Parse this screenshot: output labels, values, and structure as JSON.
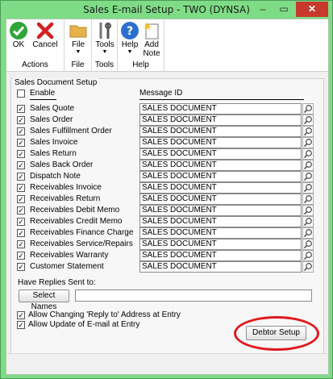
{
  "window": {
    "title": "Sales E-mail Setup  -  TWO (DYNSA)",
    "close_glyph": "✕",
    "min_glyph": "–",
    "max_glyph": "▭"
  },
  "ribbon": {
    "ok": "OK",
    "cancel": "Cancel",
    "actions_group": "Actions",
    "file": "File",
    "file_group": "File",
    "tools": "Tools",
    "tools_group": "Tools",
    "help": "Help",
    "add_note_1": "Add",
    "add_note_2": "Note",
    "help_group": "Help",
    "dropdown_glyph": "▼"
  },
  "setup": {
    "group_title": "Sales Document Setup",
    "enable_header": "Enable",
    "message_id_header": "Message ID",
    "rows": [
      {
        "label": "Sales Quote",
        "checked": true,
        "value": "SALES DOCUMENT"
      },
      {
        "label": "Sales Order",
        "checked": true,
        "value": "SALES DOCUMENT"
      },
      {
        "label": "Sales Fulfillment Order",
        "checked": true,
        "value": "SALES DOCUMENT"
      },
      {
        "label": "Sales Invoice",
        "checked": true,
        "value": "SALES DOCUMENT"
      },
      {
        "label": "Sales Return",
        "checked": true,
        "value": "SALES DOCUMENT"
      },
      {
        "label": "Sales Back Order",
        "checked": true,
        "value": "SALES DOCUMENT"
      },
      {
        "label": "Dispatch Note",
        "checked": true,
        "value": "SALES DOCUMENT"
      },
      {
        "label": "Receivables Invoice",
        "checked": true,
        "value": "SALES DOCUMENT"
      },
      {
        "label": "Receivables Return",
        "checked": true,
        "value": "SALES DOCUMENT"
      },
      {
        "label": "Receivables Debit Memo",
        "checked": true,
        "value": "SALES DOCUMENT"
      },
      {
        "label": "Receivables Credit Memo",
        "checked": true,
        "value": "SALES DOCUMENT"
      },
      {
        "label": "Receivables Finance Charge",
        "checked": true,
        "value": "SALES DOCUMENT"
      },
      {
        "label": "Receivables Service/Repairs",
        "checked": true,
        "value": "SALES DOCUMENT"
      },
      {
        "label": "Receivables Warranty",
        "checked": true,
        "value": "SALES DOCUMENT"
      },
      {
        "label": "Customer Statement",
        "checked": true,
        "value": "SALES DOCUMENT"
      }
    ],
    "replies_label": "Have Replies Sent to:",
    "select_names": "Select Names",
    "replies_value": "",
    "allow_reply": "Allow Changing 'Reply to' Address at Entry",
    "allow_reply_checked": true,
    "allow_update": "Allow Update of E-mail at Entry",
    "allow_update_checked": true,
    "debtor_setup": "Debtor Setup",
    "check_glyph": "✓"
  }
}
